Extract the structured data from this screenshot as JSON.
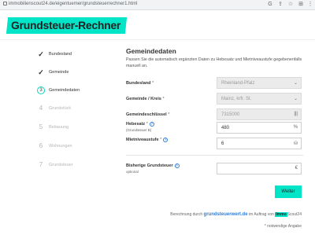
{
  "browser": {
    "url": "immobilienscout24.de/eigentuemer/grundsteuerrechner1.html",
    "icons": [
      "google-icon",
      "share-icon",
      "star-icon",
      "extensions-icon",
      "menu-icon"
    ]
  },
  "header": {
    "title": "Grundsteuer-Rechner"
  },
  "steps": [
    {
      "mark": "✓",
      "label": "Bundesland",
      "state": "done"
    },
    {
      "mark": "✓",
      "label": "Gemeinde",
      "state": "done"
    },
    {
      "mark": "3",
      "label": "Gemeindedaten",
      "state": "active"
    },
    {
      "mark": "4",
      "label": "Grundstück",
      "state": "muted"
    },
    {
      "mark": "5",
      "label": "Bebauung",
      "state": "muted"
    },
    {
      "mark": "6",
      "label": "Wohnungen",
      "state": "muted"
    },
    {
      "mark": "7",
      "label": "Grundsteuer",
      "state": "muted"
    }
  ],
  "form": {
    "heading": "Gemeindedaten",
    "intro": "Passen Sie die automatisch ergänzten Daten zu Hebesatz und Mietniveaustufe gegebenenfalls manuell an.",
    "bundesland": {
      "label": "Bundesland",
      "req": "*",
      "value": "Rheinland-Pfalz"
    },
    "gemeinde": {
      "label": "Gemeinde / Kreis",
      "req": "*",
      "value": "Mainz, krfr. St."
    },
    "schluessel": {
      "label": "Gemeindeschlüssel",
      "req": "*",
      "value": "7315000",
      "suffix": "|||"
    },
    "hebesatz": {
      "label": "Hebesatz",
      "req": "*",
      "sub": "(Grundsteuer B)",
      "value": "480",
      "suffix": "%"
    },
    "miet": {
      "label": "Mietniveaustufe",
      "req": "*",
      "value": "6",
      "suffix": "⛁"
    },
    "bisherige": {
      "label": "Bisherige Grundsteuer",
      "sub": "optional",
      "value": "",
      "suffix": "€"
    },
    "weiter": "Weiter"
  },
  "footer": {
    "calc_prefix": "Berechnung durch",
    "calc_link": "grundsteuerwert.de",
    "calc_mid": "im Auftrag von",
    "calc_brand_a": "Immo",
    "calc_brand_b": "Scout24",
    "required_note": "* notwendige Angabe"
  },
  "colors": {
    "accent": "#00e5c8",
    "link": "#2e7dd7"
  }
}
